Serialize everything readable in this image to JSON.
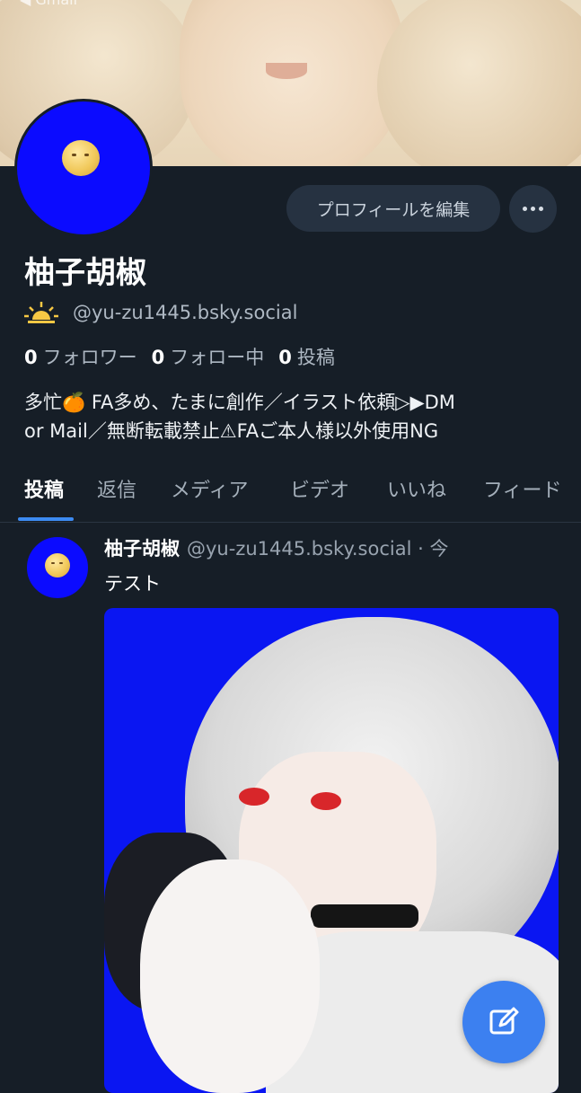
{
  "status_bar": {
    "back_app": "◀ Gmail"
  },
  "profile": {
    "display_name": "柚子胡椒",
    "handle": "@yu-zu1445.bsky.social",
    "edit_profile_label": "プロフィールを編集",
    "bio_line1": "多忙🍊 FA多め、たまに創作／イラスト依頼▷▶DM",
    "bio_line2": "or Mail／無断転載禁止⚠FAご本人様以外使用NG",
    "stats": {
      "followers_count": "0",
      "followers_label": "フォロワー",
      "following_count": "0",
      "following_label": "フォロー中",
      "posts_count": "0",
      "posts_label": "投稿"
    }
  },
  "tabs": [
    {
      "label": "投稿",
      "active": true
    },
    {
      "label": "返信"
    },
    {
      "label": "メディア"
    },
    {
      "label": "ビデオ"
    },
    {
      "label": "いいね"
    },
    {
      "label": "フィード"
    }
  ],
  "post": {
    "author_name": "柚子胡椒",
    "author_handle": "@yu-zu1445.bsky.social · 今",
    "text": "テスト"
  },
  "icons": {
    "more": "more-horizontal-icon",
    "status": "sunrise-icon",
    "compose": "compose-icon"
  },
  "colors": {
    "background": "#161e27",
    "accent": "#3c80f0",
    "avatar_bg": "#0b0bff"
  }
}
